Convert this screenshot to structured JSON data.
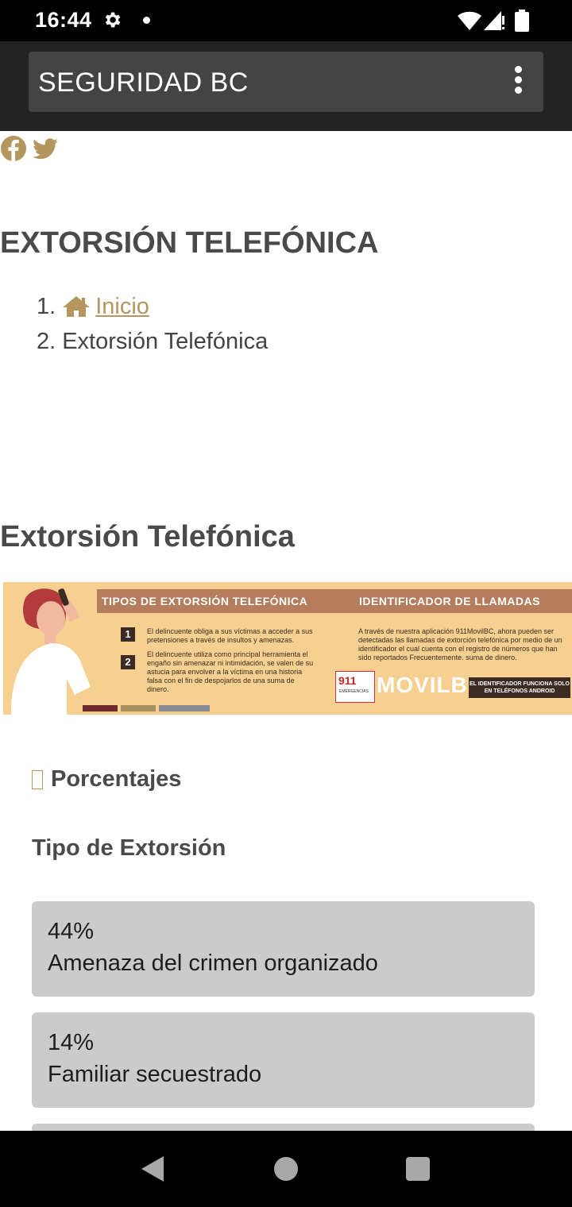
{
  "status_bar": {
    "time": "16:44"
  },
  "app_bar": {
    "title": "SEGURIDAD BC"
  },
  "social": {
    "icons": [
      "facebook-icon",
      "twitter-icon"
    ],
    "color": "#b5965e"
  },
  "page": {
    "heading": "EXTORSIÓN TELEFÓNICA",
    "breadcrumb": [
      {
        "num": "1.",
        "label": "Inicio",
        "icon": "home-icon"
      },
      {
        "num": "2.",
        "label": "Extorsión Telefónica"
      }
    ],
    "section_heading": "Extorsión Telefónica"
  },
  "banner": {
    "header_left": "TIPOS DE EXTORSIÓN TELEFÓNICA",
    "header_right": "IDENTIFICADOR DE LLAMADAS",
    "item1": "El delincuente obliga a sus víctimas a acceder a sus pretensiones a través de insultos y amenazas.",
    "item2": "El delincuente utiliza como principal herramienta el engaño sin amenazar ni intimidación, se valen de su astucia para envolver a la víctima en una historia falsa con el fin de despojarlos de una suma de dinero.",
    "right_text": "A través de nuestra aplicación 911MovilBC, ahora pueden ser detectadas las llamadas de extorción telefónica por medio de un identificador el cual cuenta con el registro de números que han sido reportados Frecuentemente. suma de dinero.",
    "emergency_digits": "911",
    "emergency_label": "EMERGENCIAS",
    "movil_label": "MOVILBC",
    "android_note": "EL IDENTIFICADOR FUNCIONA SOLO EN TELÉFONOS ANDROID"
  },
  "stats": {
    "title": "Porcentajes",
    "subtitle": "Tipo de Extorsión",
    "items": [
      {
        "percent": "44%",
        "label": "Amenaza del crimen organizado"
      },
      {
        "percent": "14%",
        "label": "Familiar secuestrado"
      }
    ]
  },
  "accent_color": "#b5965e"
}
